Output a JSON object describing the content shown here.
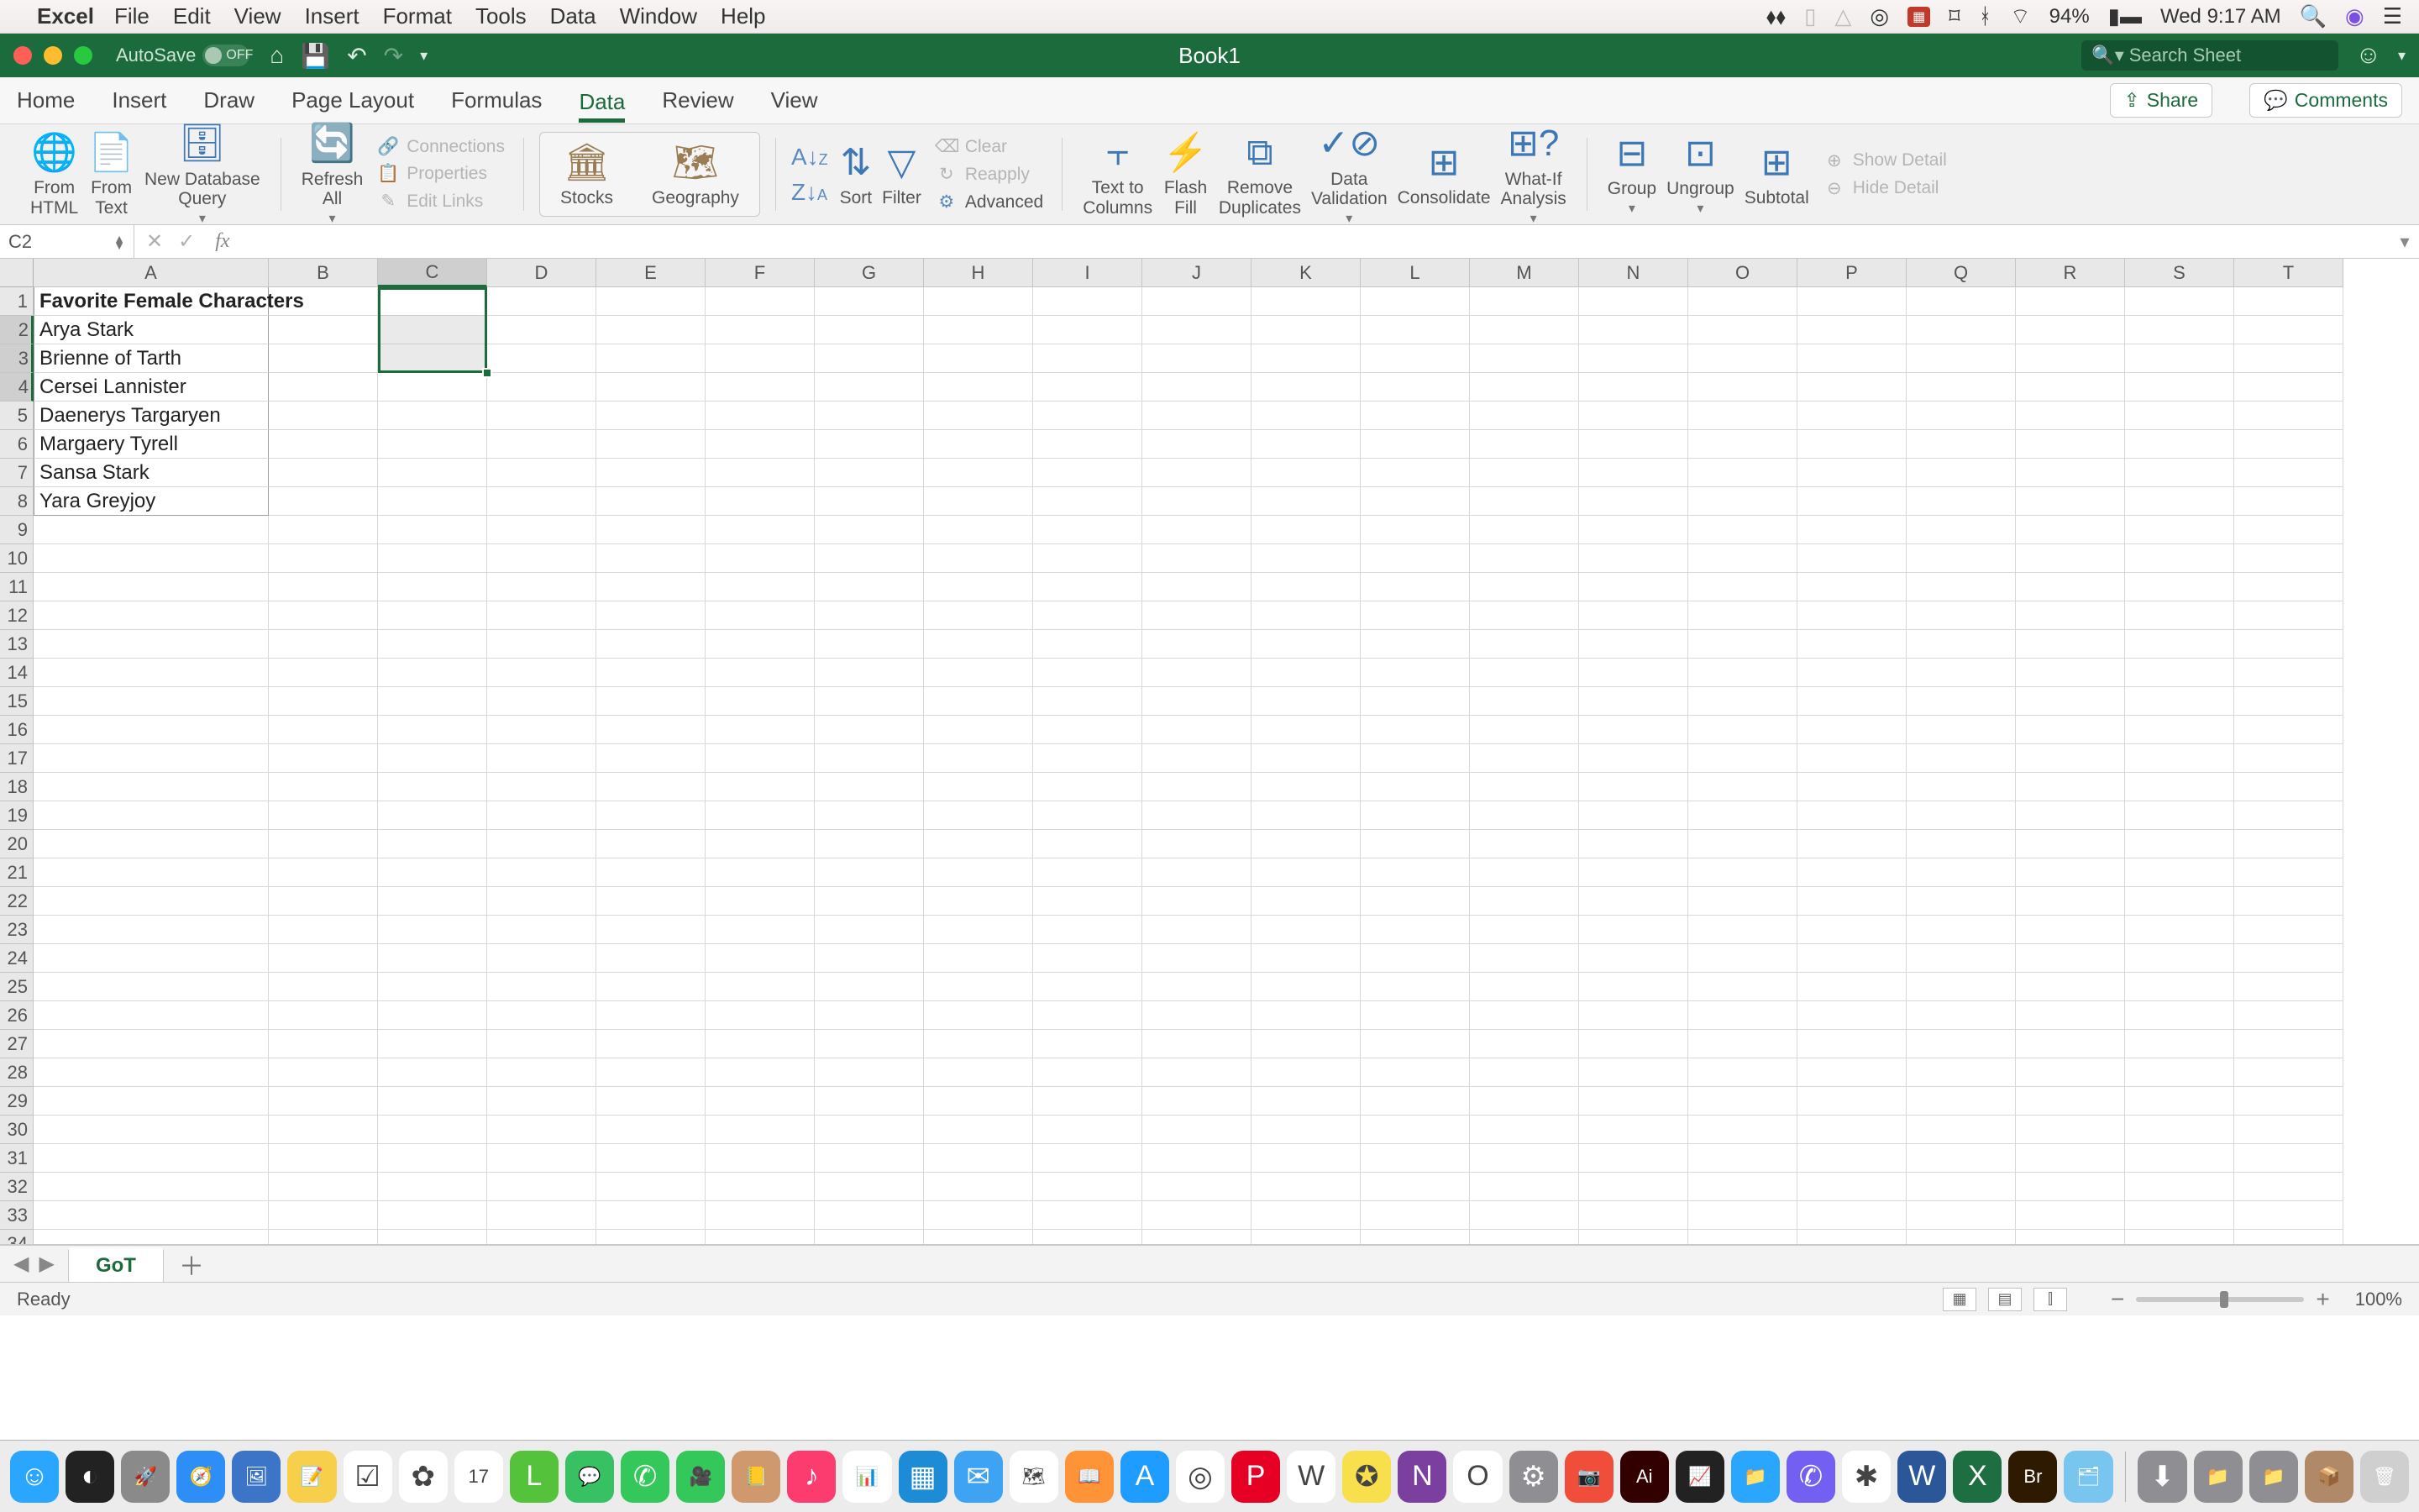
{
  "menubar": {
    "app": "Excel",
    "items": [
      "File",
      "Edit",
      "View",
      "Insert",
      "Format",
      "Tools",
      "Data",
      "Window",
      "Help"
    ],
    "battery": "94%",
    "clock": "Wed 9:17 AM"
  },
  "titlebar": {
    "autosave_label": "AutoSave",
    "autosave_state": "OFF",
    "title": "Book1",
    "search_placeholder": "Search Sheet"
  },
  "tabs": {
    "items": [
      "Home",
      "Insert",
      "Draw",
      "Page Layout",
      "Formulas",
      "Data",
      "Review",
      "View"
    ],
    "active": "Data",
    "share": "Share",
    "comments": "Comments"
  },
  "ribbon": {
    "from_html": "From\nHTML",
    "from_text": "From\nText",
    "new_db_query": "New Database\nQuery",
    "refresh_all": "Refresh\nAll",
    "connections": "Connections",
    "properties": "Properties",
    "edit_links": "Edit Links",
    "stocks": "Stocks",
    "geography": "Geography",
    "sort": "Sort",
    "filter": "Filter",
    "clear": "Clear",
    "reapply": "Reapply",
    "advanced": "Advanced",
    "text_to_cols": "Text to\nColumns",
    "flash_fill": "Flash\nFill",
    "remove_dupes": "Remove\nDuplicates",
    "data_validation": "Data\nValidation",
    "consolidate": "Consolidate",
    "what_if": "What-If\nAnalysis",
    "group": "Group",
    "ungroup": "Ungroup",
    "subtotal": "Subtotal",
    "show_detail": "Show Detail",
    "hide_detail": "Hide Detail"
  },
  "namebox": {
    "ref": "C2"
  },
  "columns": [
    "A",
    "B",
    "C",
    "D",
    "E",
    "F",
    "G",
    "H",
    "I",
    "J",
    "K",
    "L",
    "M",
    "N",
    "O",
    "P",
    "Q",
    "R",
    "S",
    "T"
  ],
  "rows": 37,
  "cells": {
    "A1": "Favorite Female Characters",
    "A2": "Arya Stark",
    "A3": "Brienne of Tarth",
    "A4": "Cersei Lannister",
    "A5": "Daenerys Targaryen",
    "A6": "Margaery Tyrell",
    "A7": "Sansa Stark",
    "A8": "Yara Greyjoy"
  },
  "selection": {
    "range": "C2:C4",
    "active": "C2"
  },
  "sheet": {
    "name": "GoT"
  },
  "status": {
    "text": "Ready",
    "zoom": "100%"
  },
  "dock_icons": [
    {
      "n": "finder",
      "c": "#2aa6ff",
      "g": "☺"
    },
    {
      "n": "siri",
      "c": "#222",
      "g": "◐"
    },
    {
      "n": "launchpad",
      "c": "#8a8a8a",
      "g": "🚀"
    },
    {
      "n": "safari",
      "c": "#2e8ef7",
      "g": "🧭"
    },
    {
      "n": "preview",
      "c": "#3c74c7",
      "g": "🖼"
    },
    {
      "n": "notes",
      "c": "#f7cf4a",
      "g": "📝"
    },
    {
      "n": "reminders",
      "c": "#fff",
      "g": "☑"
    },
    {
      "n": "photos",
      "c": "#fff",
      "g": "✿"
    },
    {
      "n": "calendar",
      "c": "#fff",
      "g": "17"
    },
    {
      "n": "line",
      "c": "#55c23b",
      "g": "L"
    },
    {
      "n": "wechat",
      "c": "#37c163",
      "g": "💬"
    },
    {
      "n": "messages",
      "c": "#34c759",
      "g": "✆"
    },
    {
      "n": "facetime",
      "c": "#34c759",
      "g": "🎥"
    },
    {
      "n": "contacts",
      "c": "#d0986d",
      "g": "📒"
    },
    {
      "n": "itunes",
      "c": "#fc3b6e",
      "g": "♪"
    },
    {
      "n": "charts",
      "c": "#fff",
      "g": "📊"
    },
    {
      "n": "keynote",
      "c": "#1e8bd6",
      "g": "▦"
    },
    {
      "n": "mail",
      "c": "#3ea3f2",
      "g": "✉"
    },
    {
      "n": "maps",
      "c": "#fff",
      "g": "🗺"
    },
    {
      "n": "ibooks",
      "c": "#ff9337",
      "g": "📖"
    },
    {
      "n": "appstore",
      "c": "#1f9cff",
      "g": "A"
    },
    {
      "n": "chrome",
      "c": "#fff",
      "g": "◎"
    },
    {
      "n": "pinterest",
      "c": "#e60023",
      "g": "P"
    },
    {
      "n": "wps",
      "c": "#fff",
      "g": "W"
    },
    {
      "n": "kakaotalk",
      "c": "#f7e04b",
      "g": "✪"
    },
    {
      "n": "onenote",
      "c": "#7b3fa0",
      "g": "N"
    },
    {
      "n": "onedrive",
      "c": "#fff",
      "g": "O"
    },
    {
      "n": "settings",
      "c": "#8e8e93",
      "g": "⚙"
    },
    {
      "n": "photobooth",
      "c": "#f04d3a",
      "g": "📷"
    },
    {
      "n": "illustrator",
      "c": "#330000",
      "g": "Ai"
    },
    {
      "n": "activity",
      "c": "#222",
      "g": "📈"
    },
    {
      "n": "finder2",
      "c": "#2aa6ff",
      "g": "📁"
    },
    {
      "n": "viber",
      "c": "#7360f2",
      "g": "✆"
    },
    {
      "n": "slack",
      "c": "#fff",
      "g": "✱"
    },
    {
      "n": "word",
      "c": "#2b579a",
      "g": "W"
    },
    {
      "n": "excel",
      "c": "#1d6f42",
      "g": "X"
    },
    {
      "n": "bridge",
      "c": "#2d1a00",
      "g": "Br"
    },
    {
      "n": "files",
      "c": "#78c5ef",
      "g": "🗂"
    },
    {
      "n": "downloads",
      "c": "#8e8e93",
      "g": "⬇"
    },
    {
      "n": "folder2",
      "c": "#8e8e93",
      "g": "📁"
    },
    {
      "n": "folder3",
      "c": "#8e8e93",
      "g": "📁"
    },
    {
      "n": "box",
      "c": "#b08968",
      "g": "📦"
    },
    {
      "n": "trash",
      "c": "#cfcfcf",
      "g": "🗑"
    }
  ]
}
